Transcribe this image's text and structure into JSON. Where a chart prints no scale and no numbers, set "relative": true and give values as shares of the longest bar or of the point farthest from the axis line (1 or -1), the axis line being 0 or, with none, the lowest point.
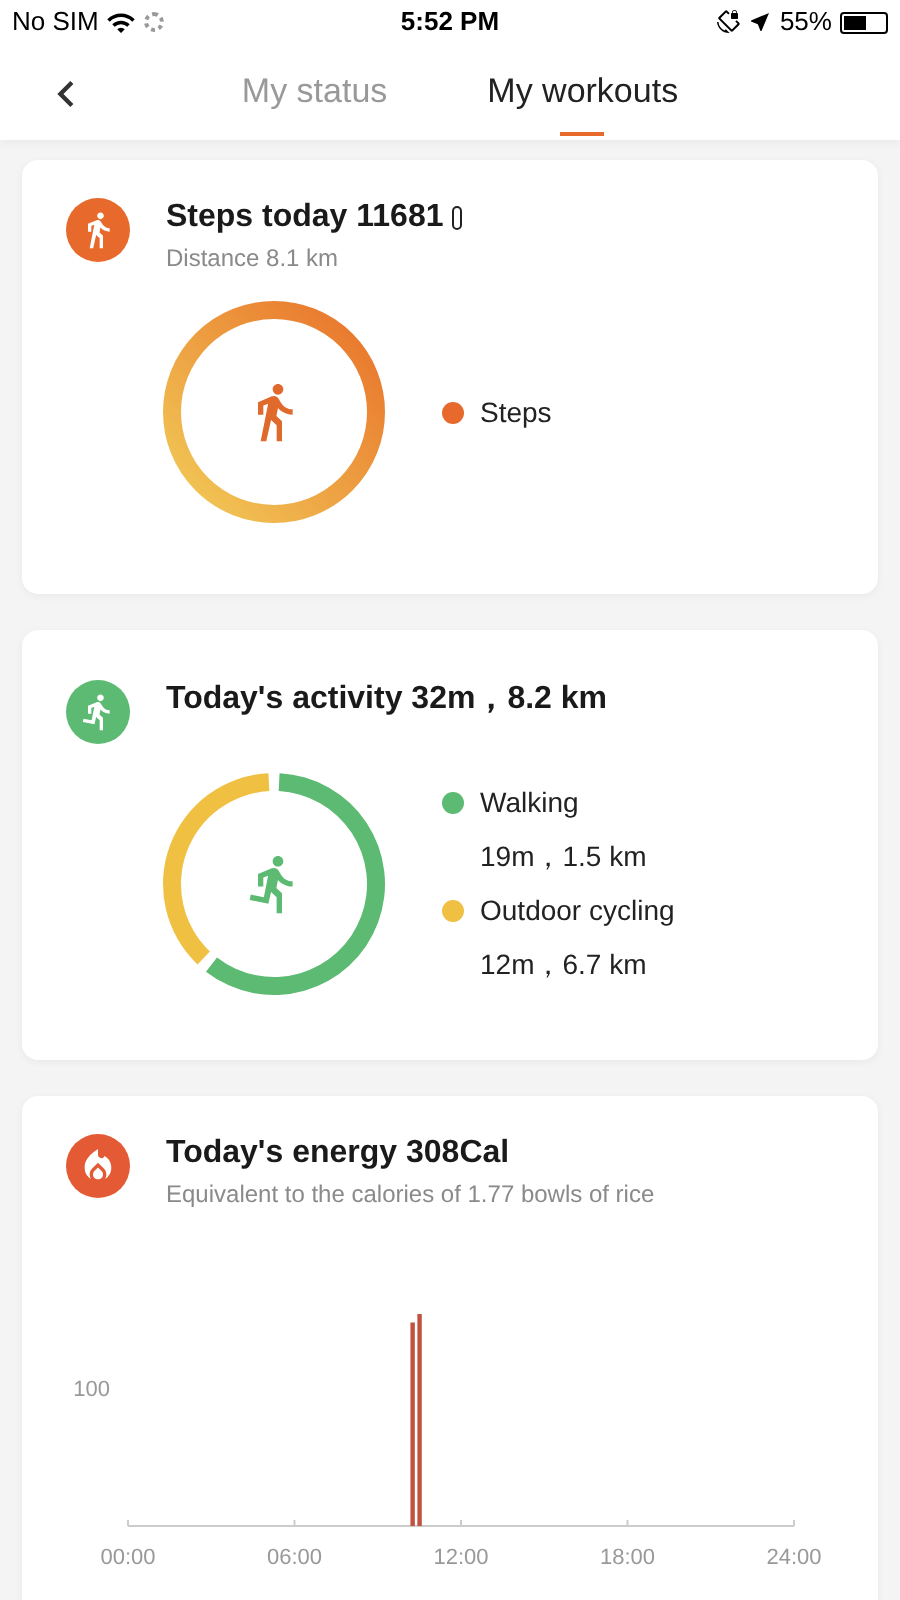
{
  "status_bar": {
    "carrier": "No SIM",
    "time": "5:52 PM",
    "battery": "55%"
  },
  "tabs": [
    {
      "label": "My status",
      "selected": false
    },
    {
      "label": "My workouts",
      "selected": true
    }
  ],
  "steps_card": {
    "title": "Steps today 11681",
    "subtitle": "Distance 8.1 km",
    "legend": [
      {
        "label": "Steps",
        "color": "#e8692c"
      }
    ]
  },
  "activity_card": {
    "title": "Today's activity 32m，8.2 km",
    "legend": [
      {
        "detail": "19m，1.5 km",
        "color": "#5cba72"
      },
      {
        "detail": "12m，6.7 km",
        "color": "#f0c043"
      }
    ],
    "chart_data": {
      "type": "donut",
      "categories": [
        "Walking",
        "Outdoor cycling"
      ],
      "values": [
        61.3,
        38.7
      ]
    }
  },
  "energy_card": {
    "title": "Today's energy 308Cal",
    "subtitle": "Equivalent to the calories of 1.77 bowls of rice",
    "axis_label": "100",
    "chart_data": {
      "type": "bar",
      "x": [
        10.25,
        10.5
      ],
      "series": [
        {
          "color": "#c0523f",
          "values": [
            0.96,
            1
          ]
        }
      ],
      "relative": true,
      "xlim": [
        0,
        24
      ],
      "xticks": [
        {
          "value": 0,
          "label": "00:00"
        },
        {
          "value": 6,
          "label": "06:00"
        },
        {
          "value": 12,
          "label": "12:00"
        },
        {
          "value": 18,
          "label": "18:00"
        },
        {
          "value": 24,
          "label": "24:00"
        }
      ]
    }
  }
}
